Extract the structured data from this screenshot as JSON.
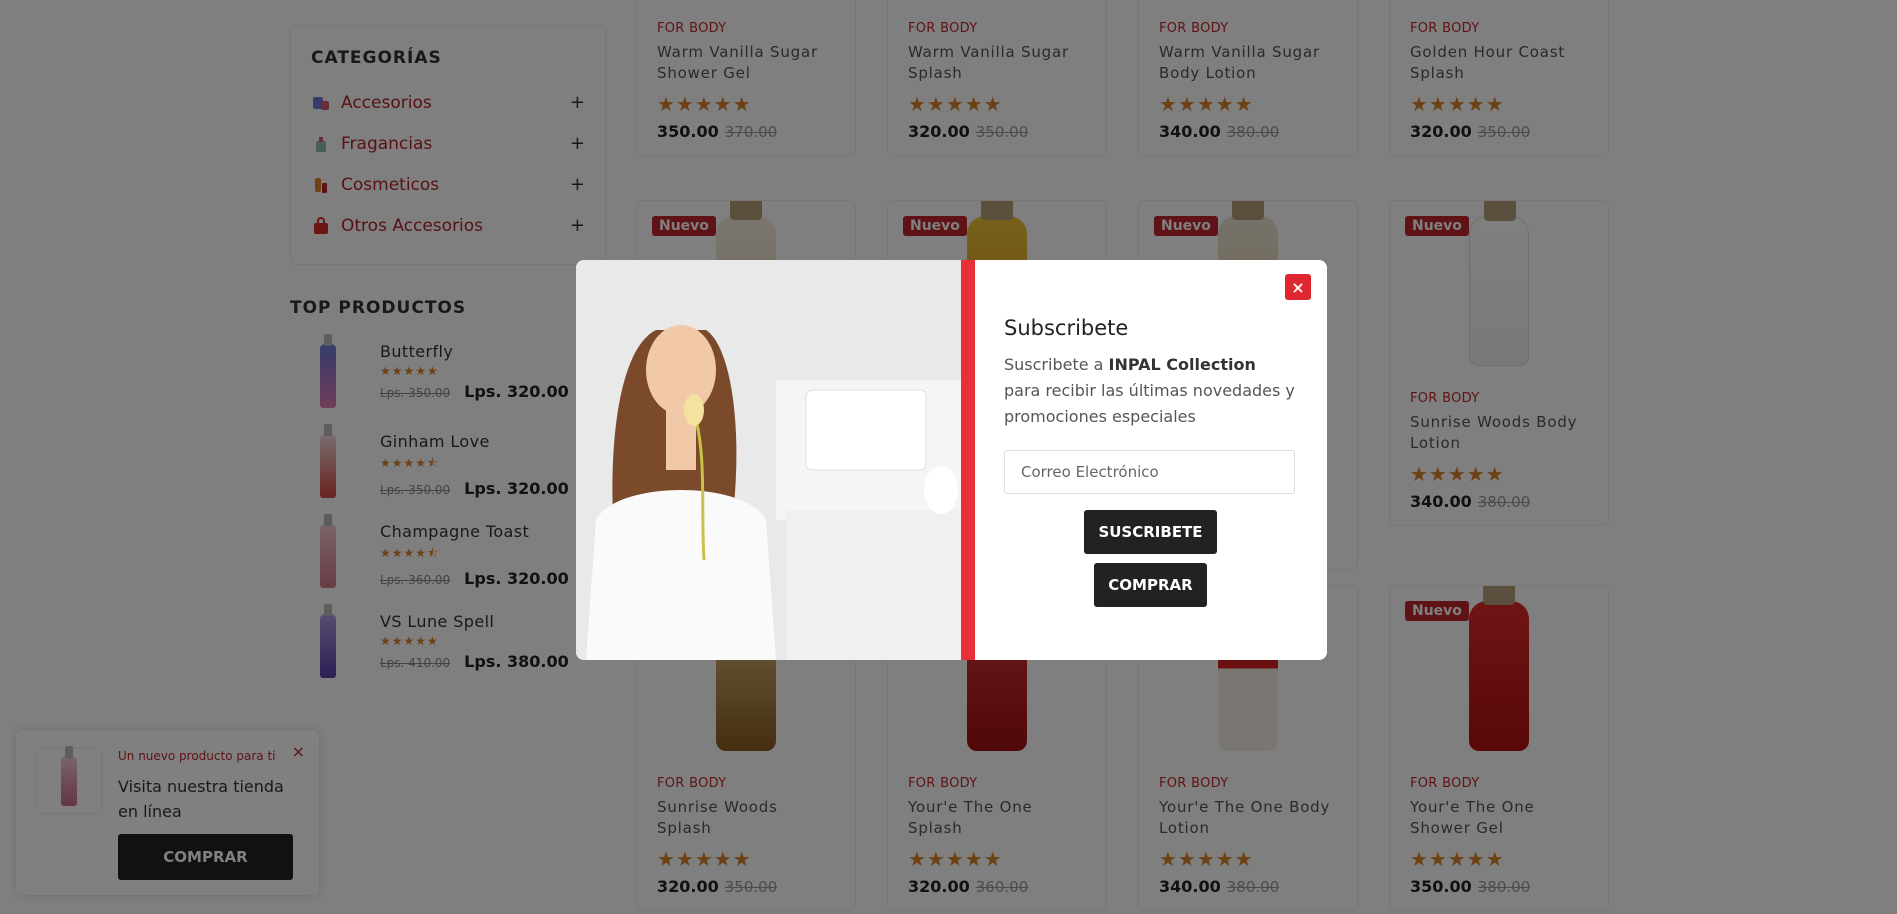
{
  "sidebar": {
    "categories_title": "CATEGORÍAS",
    "categories": [
      {
        "label": "Accesorios",
        "icon": "accessories-icon"
      },
      {
        "label": "Fragancias",
        "icon": "fragrance-icon"
      },
      {
        "label": "Cosmeticos",
        "icon": "cosmetics-icon"
      },
      {
        "label": "Otros Accesorios",
        "icon": "bag-icon"
      }
    ],
    "expand_symbol": "+",
    "top_title": "TOP PRODUCTOS",
    "top_products": [
      {
        "name": "Butterfly",
        "stars": "★★★★★",
        "old_price": "Lps. 350.00",
        "price": "Lps. 320.00"
      },
      {
        "name": "Ginham Love",
        "stars": "★★★★⯪",
        "old_price": "Lps. 350.00",
        "price": "Lps. 320.00"
      },
      {
        "name": "Champagne Toast",
        "stars": "★★★★⯪",
        "old_price": "Lps. 360.00",
        "price": "Lps. 320.00"
      },
      {
        "name": "VS Lune Spell",
        "stars": "★★★★★",
        "old_price": "Lps. 410.00",
        "price": "Lps. 380.00"
      }
    ]
  },
  "products": {
    "badge": "Nuevo",
    "brand": "FOR BODY",
    "stars": "★★★★★",
    "row1": [
      {
        "name": "Warm Vanilla Sugar Shower Gel",
        "price": "350.00",
        "old_price": "370.00"
      },
      {
        "name": "Warm Vanilla Sugar Splash",
        "price": "320.00",
        "old_price": "350.00"
      },
      {
        "name": "Warm Vanilla Sugar Body Lotion",
        "price": "340.00",
        "old_price": "380.00"
      },
      {
        "name": "Golden Hour Coast Splash",
        "price": "320.00",
        "old_price": "350.00"
      }
    ],
    "row2_visible": {
      "name": "Sunrise Woods Body Lotion",
      "price": "340.00",
      "old_price": "380.00"
    },
    "row3": [
      {
        "name": "Sunrise Woods Splash",
        "price": "320.00",
        "old_price": "350.00"
      },
      {
        "name": "Your'e The One Splash",
        "price": "320.00",
        "old_price": "360.00"
      },
      {
        "name": "Your'e The One Body Lotion",
        "price": "340.00",
        "old_price": "380.00"
      },
      {
        "name": "Your'e The One Shower Gel",
        "price": "350.00",
        "old_price": "380.00"
      }
    ]
  },
  "modal": {
    "title": "Subscribete",
    "desc_prefix": "Suscribete a ",
    "desc_brand": "INPAL Collection",
    "desc_suffix": " para recibir las últimas novedades y promociones especiales",
    "email_placeholder": "Correo Electrónico",
    "subscribe_label": "SUSCRIBETE",
    "buy_label": "COMPRAR",
    "close_symbol": "×"
  },
  "toast": {
    "label": "Un nuevo producto para ti",
    "text": "Visita nuestra tienda en línea",
    "button": "COMPRAR",
    "close_symbol": "×"
  },
  "colors": {
    "accent_red": "#c0272d",
    "star_orange": "#d9822b",
    "modal_bar": "#e8303a"
  }
}
